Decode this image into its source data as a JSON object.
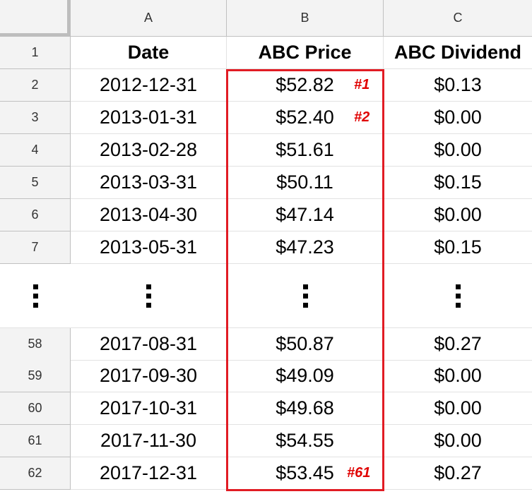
{
  "columns": [
    "A",
    "B",
    "C"
  ],
  "headers": {
    "date": "Date",
    "price": "ABC Price",
    "dividend": "ABC Dividend"
  },
  "header_row_number": "1",
  "top_rows": [
    {
      "row": "2",
      "date": "2012-12-31",
      "price": "$52.82",
      "dividend": "$0.13",
      "tag": "#1"
    },
    {
      "row": "3",
      "date": "2013-01-31",
      "price": "$52.40",
      "dividend": "$0.00",
      "tag": "#2"
    },
    {
      "row": "4",
      "date": "2013-02-28",
      "price": "$51.61",
      "dividend": "$0.00"
    },
    {
      "row": "5",
      "date": "2013-03-31",
      "price": "$50.11",
      "dividend": "$0.15"
    },
    {
      "row": "6",
      "date": "2013-04-30",
      "price": "$47.14",
      "dividend": "$0.00"
    },
    {
      "row": "7",
      "date": "2013-05-31",
      "price": "$47.23",
      "dividend": "$0.15"
    }
  ],
  "bottom_rows": [
    {
      "row": "58",
      "date": "2017-08-31",
      "price": "$50.87",
      "dividend": "$0.27"
    },
    {
      "row": "59",
      "date": "2017-09-30",
      "price": "$49.09",
      "dividend": "$0.00"
    },
    {
      "row": "60",
      "date": "2017-10-31",
      "price": "$49.68",
      "dividend": "$0.00"
    },
    {
      "row": "61",
      "date": "2017-11-30",
      "price": "$54.55",
      "dividend": "$0.00"
    },
    {
      "row": "62",
      "date": "2017-12-31",
      "price": "$53.45",
      "dividend": "$0.27",
      "tag": "#61"
    }
  ],
  "highlight_color": "#e11c24",
  "tag_color": "#e00000"
}
